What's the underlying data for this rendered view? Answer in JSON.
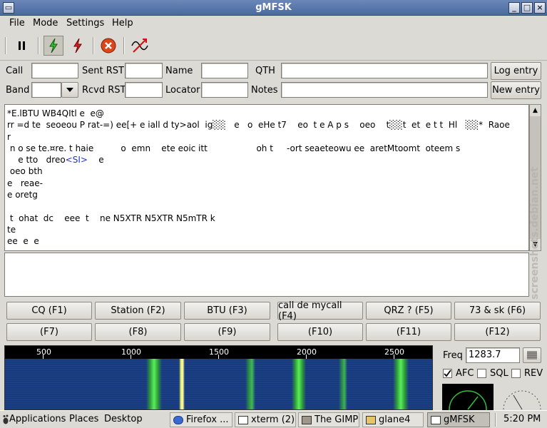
{
  "window": {
    "title": "gMFSK"
  },
  "menu": [
    "File",
    "Mode",
    "Settings",
    "Help"
  ],
  "toolbar": {
    "items": [
      "pause-icon",
      "rx-lightning-icon",
      "tx-lightning-icon",
      "abort-icon",
      "spectrum-icon"
    ]
  },
  "form": {
    "call_label": "Call",
    "sent_rst_label": "Sent RST",
    "name_label": "Name",
    "qth_label": "QTH",
    "band_label": "Band",
    "rcvd_rst_label": "Rcvd RST",
    "locator_label": "Locator",
    "notes_label": "Notes",
    "log_entry_button": "Log entry",
    "new_entry_button": "New entry"
  },
  "rx_text": {
    "lines": [
      "*E.lBTU WB4QItl e  e@",
      "rr =d te  seoeou P rat-=) ee[+ e iall d ty>aol  ig░░   e   o  eHe t7    eo  t e A p s    oeo    t░░t  et  e t t  Hl   ░░*  Raoe",
      "r",
      " n o se te.¤re. t haie          o  emn    ete eoic itt                  oh t     -ort seaeteowu ee  aretMtoomt  oteem s",
      "    e tto   dreo",
      " oeo bth",
      "e   reae-",
      "e oretg",
      "",
      " t  ohat  dc    eee  t    ne N5XTR N5XTR N5mTR k",
      "te",
      "ee  e  e"
    ],
    "special_token": "<SI>",
    "after_token": "    e"
  },
  "macros": {
    "row1": [
      "CQ (F1)",
      "Station (F2)",
      "BTU (F3)",
      "call de mycall (F4)",
      "QRZ ? (F5)",
      "73 & sk (F6)"
    ],
    "row2": [
      "(F7)",
      "(F8)",
      "(F9)",
      "(F10)",
      "(F11)",
      "(F12)"
    ]
  },
  "waterfall": {
    "scale_labels": [
      "500",
      "1000",
      "1500",
      "2000",
      "2500"
    ],
    "colors": {
      "background": "#1b3b7c",
      "signal": "#39e04a"
    }
  },
  "controls": {
    "freq_label": "Freq",
    "freq_value": "1283.7",
    "afc_label": "AFC",
    "afc_checked": true,
    "sql_label": "SQL",
    "sql_checked": false,
    "rev_label": "REV",
    "rev_checked": false
  },
  "taskbar": {
    "menus": [
      "Applications",
      "Places",
      "Desktop"
    ],
    "tasks": [
      "Firefox ...",
      "xterm (2)",
      "The GIMP",
      "glane4",
      "gMFSK"
    ],
    "active_task": "gMFSK",
    "clock": "5:20 PM"
  },
  "watermark": "screenshots.debian.net"
}
